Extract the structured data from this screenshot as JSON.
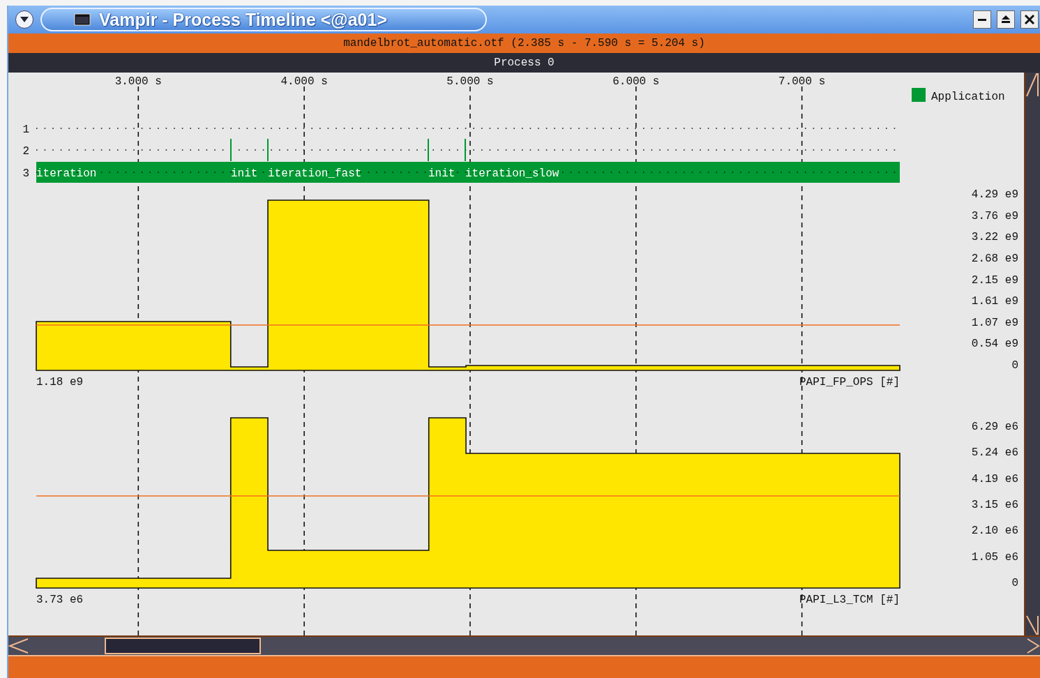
{
  "window": {
    "title": "Vampir - Process Timeline <@a01>"
  },
  "file_bar": {
    "text": "mandelbrot_automatic.otf (2.385 s - 7.590 s = 5.204 s)"
  },
  "process_bar": {
    "text": "Process 0"
  },
  "time_axis": {
    "ticks": [
      "3.000 s",
      "4.000 s",
      "5.000 s",
      "6.000 s",
      "7.000 s"
    ]
  },
  "legend": [
    {
      "label": "Application",
      "color": "#009933"
    }
  ],
  "timeline": {
    "rows": [
      {
        "label": "1"
      },
      {
        "label": "2"
      },
      {
        "label": "3",
        "segments": [
          "iteration",
          "init",
          "iteration_fast",
          "init",
          "iteration_slow"
        ]
      }
    ]
  },
  "counters": [
    {
      "name": "PAPI_FP_OPS [#]",
      "average": "1.18 e9",
      "scale": [
        "4.29 e9",
        "3.76 e9",
        "3.22 e9",
        "2.68 e9",
        "2.15 e9",
        "1.61 e9",
        "1.07 e9",
        "0.54 e9",
        "0"
      ]
    },
    {
      "name": "PAPI_L3_TCM [#]",
      "average": "3.73 e6",
      "scale": [
        "6.29 e6",
        "5.24 e6",
        "4.19 e6",
        "3.15 e6",
        "2.10 e6",
        "1.05 e6",
        "0"
      ]
    }
  ]
}
